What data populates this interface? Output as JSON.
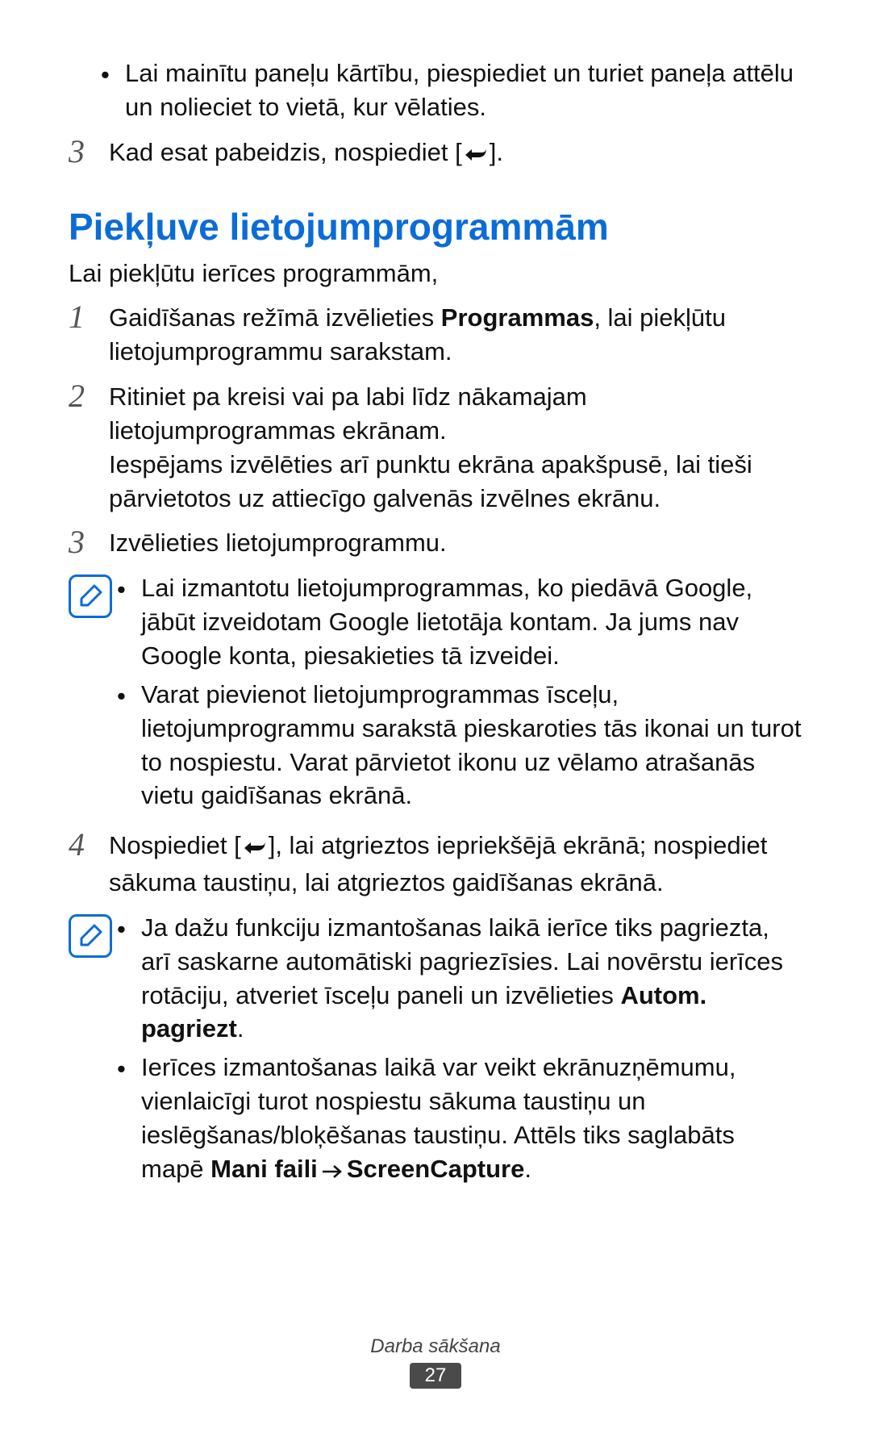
{
  "page": {
    "top_bullet": "Lai mainītu paneļu kārtību, piespiediet un turiet paneļa attēlu un nolieciet to vietā, kur vēlaties.",
    "step3_top_a": "Kad esat pabeidzis, nospiediet [",
    "step3_top_b": "].",
    "section_title": "Piekļuve lietojumprogrammām",
    "intro": "Lai piekļūtu ierīces programmām,",
    "step1_a": "Gaidīšanas režīmā izvēlieties ",
    "step1_bold": "Programmas",
    "step1_b": ", lai piekļūtu lietojumprogrammu sarakstam.",
    "step2_p1": "Ritiniet pa kreisi vai pa labi līdz nākamajam lietojumprogrammas ekrānam.",
    "step2_p2": "Iespējams izvēlēties arī punktu ekrāna apakšpusē, lai tieši pārvietotos uz attiecīgo galvenās izvēlnes ekrānu.",
    "step3b": "Izvēlieties lietojumprogrammu.",
    "note1_b1": "Lai izmantotu lietojumprogrammas, ko piedāvā Google, jābūt izveidotam Google lietotāja kontam. Ja jums nav Google konta, piesakieties tā izveidei.",
    "note1_b2": "Varat pievienot lietojumprogrammas īsceļu, lietojumprogrammu sarakstā pieskaroties tās ikonai un turot to nospiestu. Varat pārvietot ikonu uz vēlamo atrašanās vietu gaidīšanas ekrānā.",
    "step4_a": "Nospiediet [",
    "step4_b": "], lai atgrieztos iepriekšējā ekrānā; nospiediet sākuma taustiņu, lai atgrieztos gaidīšanas ekrānā.",
    "note2_b1_a": "Ja dažu funkciju izmantošanas laikā ierīce tiks pagriezta, arī saskarne automātiski pagriezīsies. Lai novērstu ierīces rotāciju, atveriet īsceļu paneli un izvēlieties ",
    "note2_b1_bold": "Autom. pagriezt",
    "note2_b1_b": ".",
    "note2_b2_a": "Ierīces izmantošanas laikā var veikt ekrānuzņēmumu, vienlaicīgi turot nospiestu sākuma taustiņu un ieslēgšanas/bloķēšanas taustiņu. Attēls tiks saglabāts mapē ",
    "note2_b2_bold1": "Mani faili",
    "note2_b2_bold2": "ScreenCapture",
    "note2_b2_b": "."
  },
  "nums": {
    "n1": "1",
    "n2": "2",
    "n3": "3",
    "n4": "4"
  },
  "footer": {
    "section": "Darba sākšana",
    "page": "27"
  }
}
